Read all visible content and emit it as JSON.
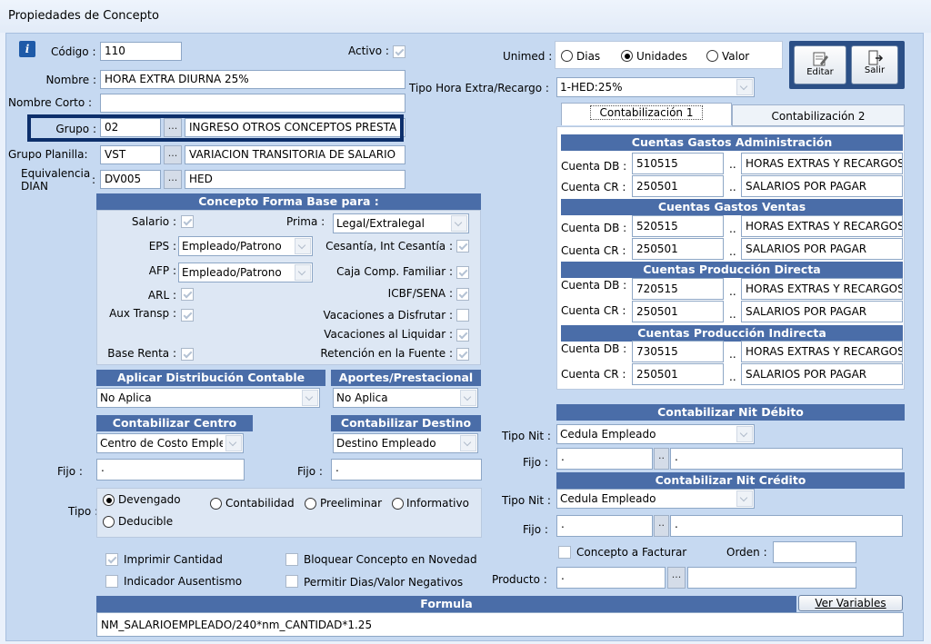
{
  "window": {
    "title": "Propiedades de Concepto"
  },
  "general": {
    "codigo_label": "Código :",
    "codigo": "110",
    "activo_label": "Activo :",
    "nombre_label": "Nombre :",
    "nombre": "HORA EXTRA DIURNA 25%",
    "nombre_corto_label": "Nombre Corto :",
    "nombre_corto": "",
    "grupo_label": "Grupo :",
    "grupo_code": "02",
    "grupo_desc": "INGRESO OTROS CONCEPTOS PRESTA",
    "grupo_planilla_label": "Grupo Planilla:",
    "grupo_planilla_code": "VST",
    "grupo_planilla_desc": "VARIACION TRANSITORIA DE SALARIO",
    "equivalencia_label_1": "Equivalencia",
    "equivalencia_label_2": "DIAN",
    "equivalencia_colon": ":",
    "equivalencia_code": "DV005",
    "equivalencia_desc": "HED",
    "dots": "..."
  },
  "base": {
    "header": "Concepto Forma Base para :",
    "salario_label": "Salario :",
    "prima_label": "Prima :",
    "prima_value": "Legal/Extralegal",
    "eps_label": "EPS :",
    "eps_value": "Empleado/Patrono",
    "cesantia_label": "Cesantía, Int Cesantía :",
    "afp_label": "AFP :",
    "afp_value": "Empleado/Patrono",
    "caja_label": "Caja Comp. Familiar :",
    "arl_label": "ARL :",
    "icbf_label": "ICBF/SENA :",
    "aux_label": "Aux Transp :",
    "vac_disfrutar_label": "Vacaciones a Disfrutar :",
    "vac_liquidar_label": "Vacaciones al Liquidar :",
    "base_renta_label": "Base Renta :",
    "retencion_label": "Retención en la Fuente :"
  },
  "distribucion": {
    "header": "Aplicar Distribución Contable",
    "value": "No Aplica"
  },
  "aportes": {
    "header": "Aportes/Prestacional",
    "value": "No Aplica"
  },
  "centro": {
    "header": "Contabilizar Centro",
    "value": "Centro de Costo Empleado",
    "fijo_label": "Fijo :",
    "fijo_value": "."
  },
  "destino": {
    "header": "Contabilizar Destino",
    "value": "Destino Empleado",
    "fijo_label": "Fijo :",
    "fijo_value": "."
  },
  "tipo": {
    "label": "Tipo :",
    "devengado": "Devengado",
    "contabilidad": "Contabilidad",
    "preeliminar": "Preeliminar",
    "informativo": "Informativo",
    "deducible": "Deducible"
  },
  "opciones": {
    "imprimir": "Imprimir Cantidad",
    "bloquear": "Bloquear Concepto en Novedad",
    "ausentismo": "Indicador Ausentismo",
    "negativos": "Permitir Dias/Valor Negativos"
  },
  "formula": {
    "header": "Formula",
    "ver_variables": "Ver Variables",
    "value": "NM_SALARIOEMPLEADO/240*nm_CANTIDAD*1.25"
  },
  "unimed": {
    "label": "Unimed :",
    "dias": "Dias",
    "unidades": "Unidades",
    "valor": "Valor"
  },
  "toolbar": {
    "editar": "Editar",
    "salir": "Salir"
  },
  "tipo_hora": {
    "label": "Tipo Hora Extra/Recargo :",
    "value": "1-HED:25%"
  },
  "tabs": {
    "tab1": "Contabilización 1",
    "tab2": "Contabilización 2"
  },
  "cuentas": {
    "db_label": "Cuenta DB :",
    "cr_label": "Cuenta CR :",
    "dots": "..",
    "admin": {
      "header": "Cuentas Gastos Administración",
      "db": "510515",
      "db_desc": "HORAS EXTRAS Y RECARGOS",
      "cr": "250501",
      "cr_desc": "SALARIOS POR PAGAR"
    },
    "ventas": {
      "header": "Cuentas Gastos Ventas",
      "db": "520515",
      "db_desc": "HORAS EXTRAS Y RECARGOS",
      "cr": "250501",
      "cr_desc": "SALARIOS POR PAGAR"
    },
    "directa": {
      "header": "Cuentas Producción Directa",
      "db": "720515",
      "db_desc": "HORAS EXTRAS Y RECARGOS",
      "cr": "250501",
      "cr_desc": "SALARIOS POR PAGAR"
    },
    "indirecta": {
      "header": "Cuentas Producción Indirecta",
      "db": "730515",
      "db_desc": "HORAS EXTRAS Y RECARGOS",
      "cr": "250501",
      "cr_desc": "SALARIOS POR PAGAR"
    }
  },
  "nit_debito": {
    "header": "Contabilizar Nit Débito",
    "tipo_label": "Tipo Nit :",
    "tipo_value": "Cedula Empleado",
    "fijo_label": "Fijo :",
    "fijo_1": ".",
    "fijo_2": ".",
    "dots": ".."
  },
  "nit_credito": {
    "header": "Contabilizar Nit Crédito",
    "tipo_label": "Tipo Nit :",
    "tipo_value": "Cedula Empleado",
    "fijo_label": "Fijo :",
    "fijo_1": ".",
    "fijo_2": ".",
    "dots": ".."
  },
  "facturar": {
    "concepto_label": "Concepto a Facturar",
    "orden_label": "Orden :",
    "orden_value": "",
    "producto_label": "Producto :",
    "producto_code": ".",
    "producto_desc": "",
    "dots": "..."
  },
  "highlight_color": "#0d2f6b"
}
